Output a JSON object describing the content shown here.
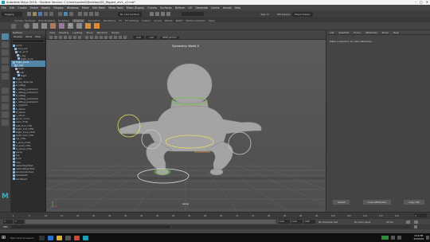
{
  "title_bar": {
    "text": "Autodesk Maya 2018 - Student Version: C:\\Users\\sadrell\\Desktop\\SG_Rigged_rev1_v2.mb*",
    "controls": [
      "–",
      "□",
      "✕"
    ]
  },
  "menu_bar": [
    "File",
    "Edit",
    "Create",
    "Select",
    "Modify",
    "Display",
    "Windows",
    "Mesh",
    "Edit Mesh",
    "Mesh Tools",
    "Mesh Display",
    "Curves",
    "Surfaces",
    "Deform",
    "UV",
    "Generate",
    "Cache",
    "Arnold",
    "Help"
  ],
  "status_line": {
    "menu_set": "Rigging",
    "live_surface": "No Live Surface",
    "sign_in": "Sign In",
    "workspace": "Maya Classic"
  },
  "shelf_tabs": [
    "Curves / Surfaces",
    "Poly Modeling",
    "Sculpting",
    "Rigging",
    "Animation",
    "Rendering",
    "FX",
    "FX Caching",
    "Custom",
    "Arnold",
    "Bifrost",
    "MASH",
    "Motion Graphics",
    "XGen"
  ],
  "shelf_active": "Rigging",
  "outliner": {
    "title": "Outliner",
    "menus": [
      "Display",
      "Show",
      "Help"
    ],
    "items": [
      {
        "label": "joint1",
        "sel": false
      },
      {
        "label": "root_joint",
        "sel": false
      },
      {
        "label": "hip_joint",
        "sel": false
      },
      {
        "label": "R_leg",
        "sel": false
      },
      {
        "label": "Right_knee",
        "sel": false
      },
      {
        "label": "Right_ankle",
        "sel": true
      },
      {
        "label": "L_leg",
        "sel": true
      },
      {
        "label": "Right",
        "sel": false
      },
      {
        "label": "Left",
        "sel": false
      },
      {
        "label": "Right",
        "sel": false
      },
      {
        "label": "Right",
        "sel": false
      },
      {
        "label": "R_leg_ikHandle",
        "sel": false
      },
      {
        "label": "R_leftleg",
        "sel": false
      },
      {
        "label": "L_leftleg_poleVector",
        "sel": false
      },
      {
        "label": "L_leftleg_poleVector",
        "sel": false
      },
      {
        "label": "R_leftleg",
        "sel": false
      },
      {
        "label": "R_leftleg_poleVector",
        "sel": false
      },
      {
        "label": "L_leftleg_poleVector",
        "sel": false
      },
      {
        "label": "L_rightarm",
        "sel": false
      },
      {
        "label": "R_elbow",
        "sel": false
      },
      {
        "label": "R_elbow",
        "sel": false
      },
      {
        "label": "L_elbow",
        "sel": false
      },
      {
        "label": "spine_curve",
        "sel": false
      },
      {
        "label": "neck_CTRL",
        "sel": false
      },
      {
        "label": "Left_foot_CTRL",
        "sel": false
      },
      {
        "label": "Right_foot_CTRL",
        "sel": false
      },
      {
        "label": "Right_knee_CTRL",
        "sel": false
      },
      {
        "label": "Right_foot_CTRL",
        "sel": false
      },
      {
        "label": "hip_CTRL",
        "sel": false
      },
      {
        "label": "L_wrist_CTRL",
        "sel": false
      },
      {
        "label": "R_wrist_CTRL",
        "sel": false
      },
      {
        "label": "R_elbow_CTRL",
        "sel": false
      },
      {
        "label": "persp",
        "sel": false
      },
      {
        "label": "top",
        "sel": false
      },
      {
        "label": "front",
        "sel": false
      },
      {
        "label": "side",
        "sel": false
      },
      {
        "label": "defaultLightSet",
        "sel": false
      },
      {
        "label": "defaultObjectSet",
        "sel": false
      },
      {
        "label": "skinCluster1Set",
        "sel": false
      },
      {
        "label": "tweakSet1",
        "sel": false
      },
      {
        "label": "bindPose1",
        "sel": false
      }
    ]
  },
  "viewport": {
    "menus": [
      "View",
      "Shading",
      "Lighting",
      "Show",
      "Renderer",
      "Panels"
    ],
    "symmetry_label": "Symmetry: World X",
    "camera_label": "persp",
    "color_space": "sRGB gamma"
  },
  "attribute_editor": {
    "tabs": [
      "List",
      "Selected",
      "Focus",
      "Attributes",
      "Show",
      "Help"
    ],
    "message": "Make a selection to view attributes",
    "buttons": [
      "Select",
      "Load Attributes",
      "Copy Tab"
    ]
  },
  "time_slider": {
    "ticks": [
      "1",
      "5",
      "10",
      "15",
      "20",
      "25",
      "30",
      "35",
      "40",
      "45",
      "50",
      "55",
      "60",
      "65",
      "70",
      "75",
      "80",
      "85",
      "90",
      "95",
      "100",
      "105",
      "110",
      "115",
      "120"
    ],
    "current_frame": "1"
  },
  "range_slider": {
    "start": "1",
    "inner_start": "1",
    "inner_end": "120",
    "end": "120",
    "end2": "200",
    "character_set": "No Character Set",
    "anim_layer": "No Anim Layer",
    "fps": "24 fps"
  },
  "command_line": {
    "lang": "MEL"
  },
  "taskbar": {
    "search": "Type here to search",
    "clock": "4:16 PM",
    "date": "2/3/2019"
  },
  "colors": {
    "maya_blue": "#5285a6",
    "viewport_top": "#5b5b5b",
    "viewport_bottom": "#4e4e4e",
    "mesh": "#a4a4a4",
    "ctrl_green": "#72c043",
    "ctrl_yellow": "#e9e25b"
  }
}
